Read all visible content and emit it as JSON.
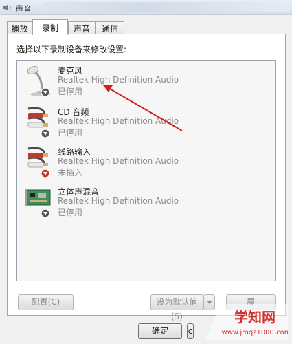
{
  "window": {
    "title": "声音"
  },
  "tabs": [
    {
      "label": "播放"
    },
    {
      "label": "录制"
    },
    {
      "label": "声音"
    },
    {
      "label": "通信"
    }
  ],
  "instruction": "选择以下录制设备来修改设置:",
  "devices": [
    {
      "name": "麦克风",
      "driver": "Realtek High Definition Audio",
      "status": "已停用",
      "icon": "microphone-icon"
    },
    {
      "name": "CD 音频",
      "driver": "Realtek High Definition Audio",
      "status": "已停用",
      "icon": "rca-cable-icon"
    },
    {
      "name": "线路输入",
      "driver": "Realtek High Definition Audio",
      "status": "未插入",
      "icon": "rca-cable-icon"
    },
    {
      "name": "立体声混音",
      "driver": "Realtek High Definition Audio",
      "status": "已停用",
      "icon": "sound-card-icon"
    }
  ],
  "buttons": {
    "configure": "配置(C)",
    "set_default": "设为默认值(S)",
    "properties": "属",
    "ok": "确定",
    "cancel": "c"
  },
  "watermark": {
    "brand": "学知网",
    "url": "www.jmqz1000.com"
  },
  "colors": {
    "arrow": "#d21e1e",
    "disabled_badge": "#555555",
    "unplugged_badge": "#c0392b"
  }
}
